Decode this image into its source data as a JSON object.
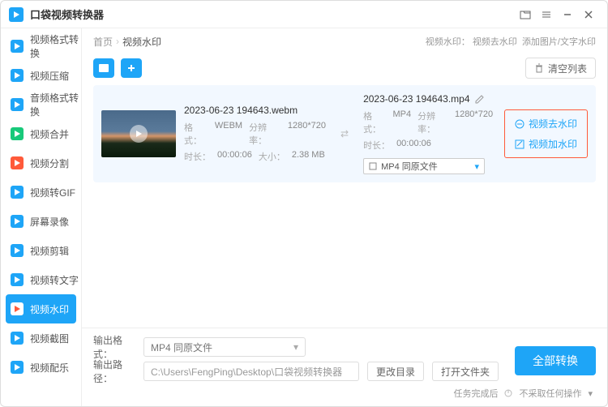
{
  "app": {
    "title": "口袋视频转换器"
  },
  "sidebar": {
    "items": [
      {
        "label": "视频格式转换",
        "color": "#1ea5f7"
      },
      {
        "label": "视频压缩",
        "color": "#1ea5f7"
      },
      {
        "label": "音频格式转换",
        "color": "#1ea5f7"
      },
      {
        "label": "视频合并",
        "color": "#18c97a"
      },
      {
        "label": "视频分割",
        "color": "#ff5a3a"
      },
      {
        "label": "视频转GIF",
        "color": "#1ea5f7"
      },
      {
        "label": "屏幕录像",
        "color": "#1ea5f7"
      },
      {
        "label": "视频剪辑",
        "color": "#1ea5f7"
      },
      {
        "label": "视频转文字",
        "color": "#1ea5f7"
      },
      {
        "label": "视频水印",
        "color": "#ff5a3a"
      },
      {
        "label": "视频截图",
        "color": "#1ea5f7"
      },
      {
        "label": "视频配乐",
        "color": "#1ea5f7"
      }
    ],
    "active_index": 9
  },
  "breadcrumb": {
    "home": "首页",
    "current": "视频水印",
    "hint_label": "视频水印：",
    "hint_a": "视频去水印",
    "hint_b": "添加图片/文字水印"
  },
  "toolbar": {
    "clear": "清空列表"
  },
  "file": {
    "src_name": "2023-06-23 194643.webm",
    "src_fmt_label": "格式：",
    "src_fmt": "WEBM",
    "src_res_label": "分辨率：",
    "src_res": "1280*720",
    "src_dur_label": "时长：",
    "src_dur": "00:00:06",
    "src_size_label": "大小：",
    "src_size": "2.38 MB",
    "dst_name": "2023-06-23 194643.mp4",
    "dst_fmt_label": "格式：",
    "dst_fmt": "MP4",
    "dst_res_label": "分辨率：",
    "dst_res": "1280*720",
    "dst_dur_label": "时长：",
    "dst_dur": "00:00:06",
    "dst_format_sel": "MP4 同原文件",
    "wm_remove": "视频去水印",
    "wm_add": "视频加水印"
  },
  "bottom": {
    "format_label": "输出格式：",
    "format_value": "MP4 同原文件",
    "path_label": "输出路径：",
    "path_value": "C:\\Users\\FengPing\\Desktop\\口袋视频转换器",
    "change_dir": "更改目录",
    "open_dir": "打开文件夹",
    "convert": "全部转换",
    "status_label": "任务完成后",
    "status_action": "不采取任何操作"
  }
}
